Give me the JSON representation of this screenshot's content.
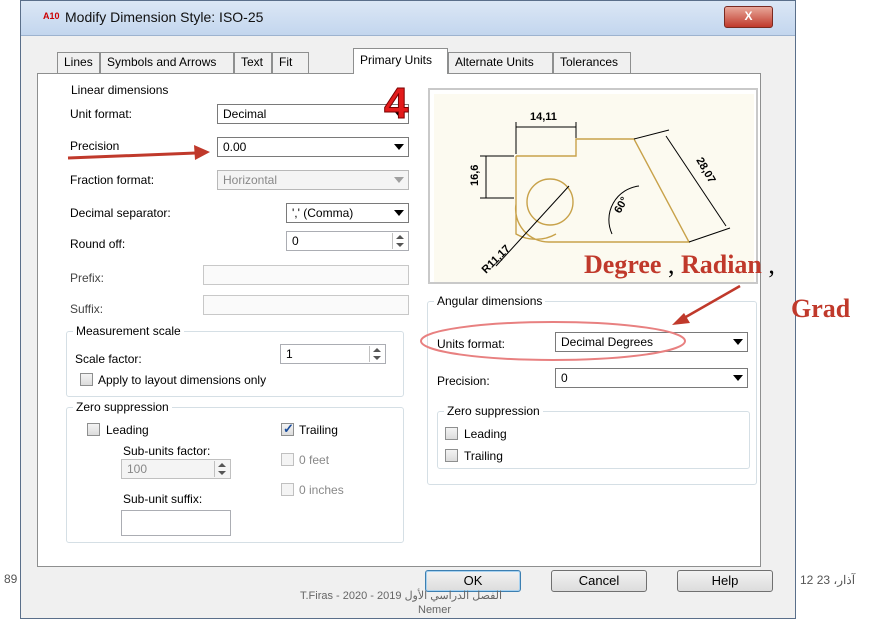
{
  "page_left_number": "89",
  "footer": {
    "left": "T.Firas  -  2020 - 2019 الفصل الدراسي الأول",
    "left2": "Nemer",
    "right": "12 آذار، 23"
  },
  "window": {
    "title": "Modify Dimension Style: ISO-25",
    "close_label": "X",
    "app_icon": "A10"
  },
  "tabs": [
    {
      "label": "Lines",
      "active": false
    },
    {
      "label": "Symbols and Arrows",
      "active": false
    },
    {
      "label": "Text",
      "active": false
    },
    {
      "label": "Fit",
      "active": false
    },
    {
      "label": "Primary Units",
      "active": true
    },
    {
      "label": "Alternate Units",
      "active": false
    },
    {
      "label": "Tolerances",
      "active": false
    }
  ],
  "linear": {
    "title": "Linear dimensions",
    "unit_format_label": "Unit format:",
    "unit_format_value": "Decimal",
    "precision_label": "Precision",
    "precision_value": "0.00",
    "fraction_format_label": "Fraction format:",
    "fraction_format_value": "Horizontal",
    "decimal_separator_label": "Decimal separator:",
    "decimal_separator_value": "',' (Comma)",
    "round_off_label": "Round off:",
    "round_off_value": "0",
    "prefix_label": "Prefix:",
    "prefix_value": "",
    "suffix_label": "Suffix:",
    "suffix_value": ""
  },
  "measurement": {
    "title": "Measurement scale",
    "scale_factor_label": "Scale factor:",
    "scale_factor_value": "1",
    "apply_layout_label": "Apply to layout dimensions only",
    "apply_layout_checked": false
  },
  "zero_linear": {
    "title": "Zero suppression",
    "leading_label": "Leading",
    "leading_checked": false,
    "trailing_label": "Trailing",
    "trailing_checked": true,
    "subunits_factor_label": "Sub-units factor:",
    "subunits_factor_value": "100",
    "subunit_suffix_label": "Sub-unit suffix:",
    "subunit_suffix_value": "",
    "zero_feet_label": "0 feet",
    "zero_inches_label": "0 inches"
  },
  "preview": {
    "dim_top": "14,11",
    "dim_left": "16,6",
    "dim_right": "28,07",
    "dim_angle": "60°",
    "dim_radius": "R11,17"
  },
  "angular": {
    "title": "Angular dimensions",
    "units_format_label": "Units format:",
    "units_format_value": "Decimal Degrees",
    "precision_label": "Precision:",
    "precision_value": "0"
  },
  "zero_angular": {
    "title": "Zero suppression",
    "leading_label": "Leading",
    "leading_checked": false,
    "trailing_label": "Trailing",
    "trailing_checked": false
  },
  "buttons": {
    "ok": "OK",
    "cancel": "Cancel",
    "help": "Help"
  },
  "annotation": {
    "step_number": "4",
    "degree": "Degree",
    "comma1": " , ",
    "radian": "Radian",
    "comma2": " ,",
    "grad": "Grad",
    "colors": {
      "annotation": "#c0392b",
      "step": "#e31b1b",
      "highlight": "#e88080",
      "drawing": "#c8a24a"
    }
  }
}
